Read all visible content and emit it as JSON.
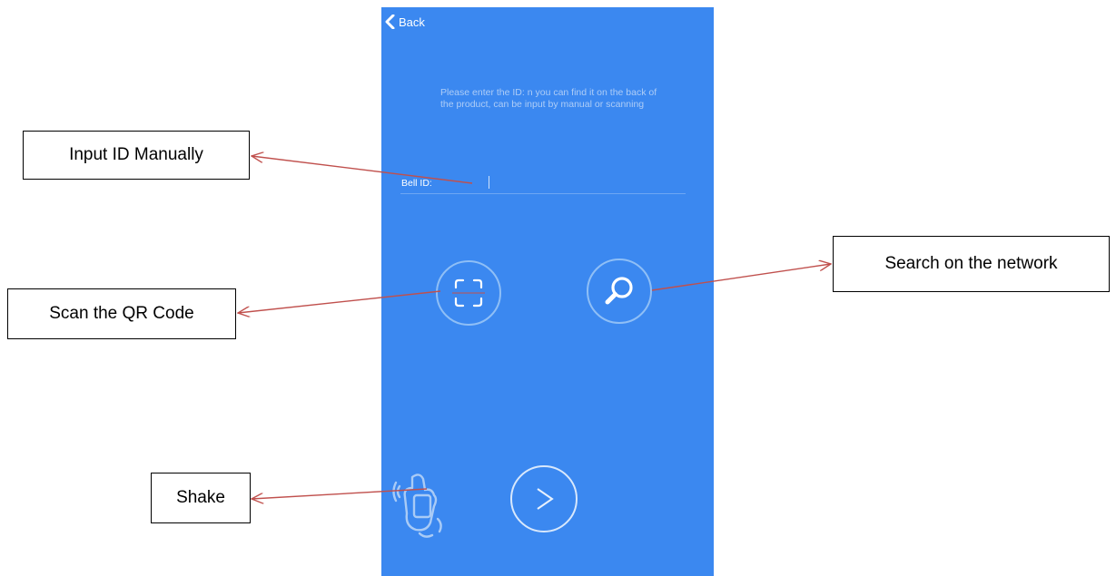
{
  "app": {
    "back_label": "Back",
    "hint": "Please enter the ID: n you can find it on the back of the product, can be input by manual or scanning",
    "bell_id_label": "Bell ID:",
    "bell_id_value": "",
    "buttons": {
      "scan": "qr-scan-icon",
      "search": "magnifier-icon",
      "next": "chevron-right-icon",
      "shake": "shake-phone-icon"
    },
    "colors": {
      "background": "#3b88f0",
      "text": "#ffffff",
      "hint_text": "#aecdf7",
      "button_ring": "#8fbff6"
    }
  },
  "annotations": {
    "input_manually": "Input ID Manually",
    "scan_qr": "Scan the QR Code",
    "shake": "Shake",
    "search_network": "Search on the network",
    "arrow_color": "#c0504d"
  }
}
